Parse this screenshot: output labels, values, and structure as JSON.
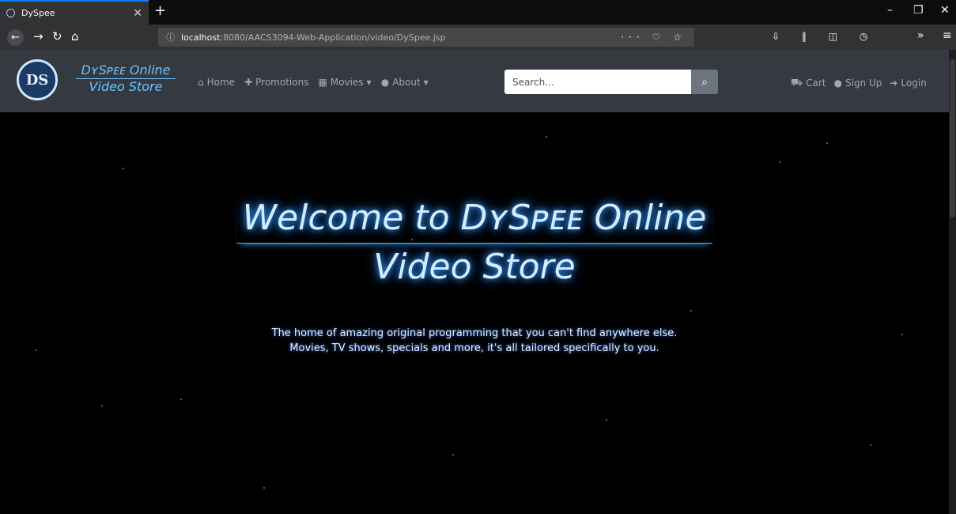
{
  "browser": {
    "tab_title": "DySpee",
    "url_host": "localhost",
    "url_path": ":8080/AACS3094-Web-Application/video/DySpee.jsp",
    "url_more": "···"
  },
  "site": {
    "logo_text": "DS",
    "brand_line1": "DʏSᴘᴇᴇ Online",
    "brand_line2": "Video Store",
    "menu": [
      {
        "label": "Home",
        "icon": "home-icon"
      },
      {
        "label": "Promotions",
        "icon": "gift-icon"
      },
      {
        "label": "Movies",
        "icon": "film-icon"
      },
      {
        "label": "About",
        "icon": "info-icon"
      }
    ],
    "search": {
      "placeholder": "Search..."
    },
    "right_menu": [
      {
        "label": "Cart",
        "icon": "cart-icon"
      },
      {
        "label": "Sign Up",
        "icon": "user-icon"
      },
      {
        "label": "Login",
        "icon": "login-icon"
      }
    ]
  },
  "hero": {
    "title_line1": "Welcome to DʏSᴘᴇᴇ Online",
    "title_line2": "Video Store",
    "tagline_line1": "The home of amazing original programming that you can't find anywhere else.",
    "tagline_line2": "Movies, TV shows, specials and more, it's all tailored specifically to you."
  },
  "colors": {
    "accent": "#0a84ff",
    "navbar_bg": "#343a40",
    "brand_blue": "#6ec1ff"
  }
}
